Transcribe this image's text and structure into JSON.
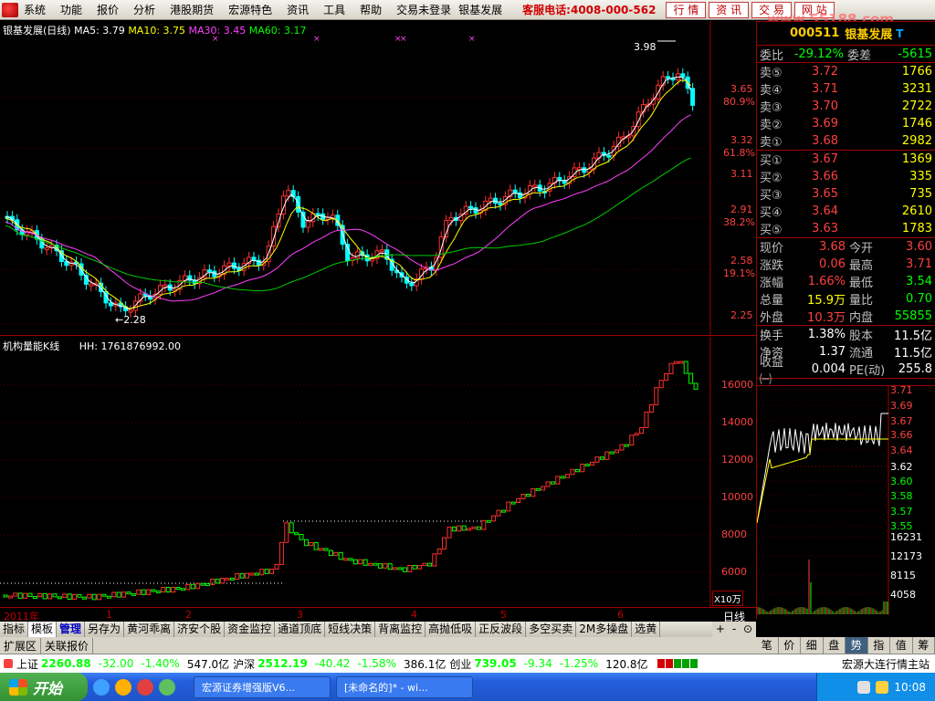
{
  "menubar": {
    "items": [
      "系统",
      "功能",
      "报价",
      "分析",
      "港股期货",
      "宏源特色",
      "资讯",
      "工具",
      "帮助"
    ],
    "login_status": "交易未登录",
    "current_stock": "银基发展",
    "hotline": "客服电话:4008-000-562",
    "right_buttons": [
      "行 情",
      "资 讯",
      "交 易",
      "网 站"
    ],
    "watermark": "www.55188.com"
  },
  "kline": {
    "title": "银基发展(日线)",
    "ma": [
      {
        "label": "MA5: 3.79",
        "color": "#ffffff"
      },
      {
        "label": "MA10: 3.75",
        "color": "#ffff00"
      },
      {
        "label": "MA30: 3.45",
        "color": "#ff40ff"
      },
      {
        "label": "MA60: 3.17",
        "color": "#00ff00"
      }
    ],
    "high_label": "3.98",
    "low_label": "←2.28",
    "axis": [
      {
        "v": "3.65",
        "p": "80.9%"
      },
      {
        "v": "3.32",
        "p": "61.8%"
      },
      {
        "v": "3.11",
        "p": ""
      },
      {
        "v": "2.91",
        "p": "38.2%"
      },
      {
        "v": "2.58",
        "p": "19.1%"
      },
      {
        "v": "2.25",
        "p": ""
      }
    ]
  },
  "volume": {
    "title": "机构量能K线",
    "hh": "HH: 1761876992.00",
    "axis": [
      "16000",
      "14000",
      "12000",
      "10000",
      "8000",
      "6000"
    ],
    "unit": "X10万"
  },
  "timeline": [
    "2011年",
    "1",
    "2",
    "3",
    "4",
    "5",
    "6"
  ],
  "quote": {
    "code": "000511",
    "name": "银基发展",
    "weibi_label": "委比",
    "weibi": "-29.12%",
    "weicha_label": "委差",
    "weicha": "-5615",
    "sell": [
      {
        "l": "卖⑤",
        "p": "3.72",
        "v": "1766"
      },
      {
        "l": "卖④",
        "p": "3.71",
        "v": "3231"
      },
      {
        "l": "卖③",
        "p": "3.70",
        "v": "2722"
      },
      {
        "l": "卖②",
        "p": "3.69",
        "v": "1746"
      },
      {
        "l": "卖①",
        "p": "3.68",
        "v": "2982"
      }
    ],
    "buy": [
      {
        "l": "买①",
        "p": "3.67",
        "v": "1369"
      },
      {
        "l": "买②",
        "p": "3.66",
        "v": "335"
      },
      {
        "l": "买③",
        "p": "3.65",
        "v": "735"
      },
      {
        "l": "买④",
        "p": "3.64",
        "v": "2610"
      },
      {
        "l": "买⑤",
        "p": "3.63",
        "v": "1783"
      }
    ],
    "stats": [
      {
        "a": "现价",
        "b": "3.68",
        "bc": "r",
        "c": "今开",
        "d": "3.60",
        "dc": "r"
      },
      {
        "a": "涨跌",
        "b": "0.06",
        "bc": "r",
        "c": "最高",
        "d": "3.71",
        "dc": "r"
      },
      {
        "a": "涨幅",
        "b": "1.66%",
        "bc": "r",
        "c": "最低",
        "d": "3.54",
        "dc": "g"
      },
      {
        "a": "总量",
        "b": "15.9万",
        "bc": "y",
        "c": "量比",
        "d": "0.70",
        "dc": "g"
      },
      {
        "a": "外盘",
        "b": "10.3万",
        "bc": "r",
        "c": "内盘",
        "d": "55855",
        "dc": "g"
      }
    ],
    "stats2": [
      {
        "a": "换手",
        "b": "1.38%",
        "c": "股本",
        "d": "11.5亿"
      },
      {
        "a": "净资",
        "b": "1.37",
        "c": "流通",
        "d": "11.5亿"
      },
      {
        "a": "收益㈠",
        "b": "0.004",
        "c": "PE(动)",
        "d": "255.8"
      }
    ],
    "intraday_axis": [
      "3.71",
      "3.69",
      "3.67",
      "3.66",
      "3.64",
      "3.62",
      "3.60",
      "3.58",
      "3.57",
      "3.55"
    ],
    "intraday_vol_axis": [
      "16231",
      "12173",
      "8115",
      "4058"
    ]
  },
  "tabs": [
    "指标",
    "模板",
    "管理",
    "另存为",
    "黄河乖离",
    "济安个股",
    "资金监控",
    "通道顶底",
    "短线决策",
    "背离监控",
    "高抛低吸",
    "正反波段",
    "多空买卖",
    "2M多操盘",
    "选黄"
  ],
  "daily_label": "日线",
  "zoom_buttons": [
    "+",
    "-",
    "⊙"
  ],
  "ext_tabs": [
    "扩展区",
    "关联报价"
  ],
  "right_tabs": [
    "笔",
    "价",
    "细",
    "盘",
    "势",
    "指",
    "值",
    "筹"
  ],
  "index_bar": [
    {
      "lab": "上证",
      "v": "2260.88",
      "c": "-32.00",
      "p": "-1.40%",
      "a": "547.0亿"
    },
    {
      "lab": "沪深",
      "v": "2512.19",
      "c": "-40.42",
      "p": "-1.58%",
      "a": "386.1亿"
    },
    {
      "lab": "创业",
      "v": "739.05",
      "c": "-9.34",
      "p": "-1.25%",
      "a": "120.8亿"
    }
  ],
  "index_bar_right": "宏源大连行情主站",
  "taskbar": {
    "start": "开始",
    "tasks": [
      "宏源证券增强版V6...",
      "[未命名的]* - wi..."
    ],
    "clock": "10:08"
  }
}
